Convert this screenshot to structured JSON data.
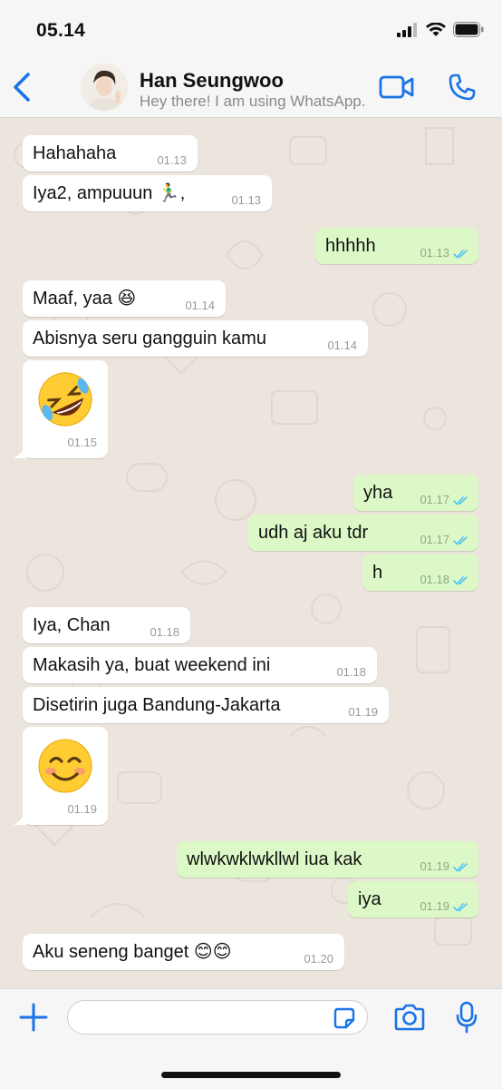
{
  "status_bar": {
    "time": "05.14"
  },
  "header": {
    "contact_name": "Han Seungwoo",
    "contact_status": "Hey there! I am using WhatsApp.",
    "back_icon": "chevron-left-icon",
    "video_icon": "video-camera-icon",
    "call_icon": "phone-icon"
  },
  "colors": {
    "accent": "#1a73e8",
    "incoming_bubble": "#ffffff",
    "outgoing_bubble": "#dcf8c6",
    "chat_background": "#ece5dd",
    "read_ticks": "#4fc3f7"
  },
  "messages": [
    {
      "direction": "in",
      "text": "Hahahaha",
      "time": "01.13"
    },
    {
      "direction": "in",
      "text": "Iya2, ampuuun 🏃‍♂️,",
      "time": "01.13"
    },
    {
      "direction": "out",
      "text": "hhhhh",
      "time": "01.13",
      "status": "read"
    },
    {
      "direction": "in",
      "text": "Maaf, yaa 😆",
      "time": "01.14"
    },
    {
      "direction": "in",
      "text": "Abisnya seru gangguin kamu",
      "time": "01.14"
    },
    {
      "direction": "in",
      "type": "sticker",
      "emoji": "rolling-on-floor-laughing",
      "time": "01.15"
    },
    {
      "direction": "out",
      "text": "yha",
      "time": "01.17",
      "status": "read"
    },
    {
      "direction": "out",
      "text": "udh aj aku tdr",
      "time": "01.17",
      "status": "read"
    },
    {
      "direction": "out",
      "text": "h",
      "time": "01.18",
      "status": "read"
    },
    {
      "direction": "in",
      "text": "Iya, Chan",
      "time": "01.18"
    },
    {
      "direction": "in",
      "text": "Makasih ya, buat weekend ini",
      "time": "01.18"
    },
    {
      "direction": "in",
      "text": "Disetirin juga Bandung-Jakarta",
      "time": "01.19"
    },
    {
      "direction": "in",
      "type": "sticker",
      "emoji": "smiling-face",
      "time": "01.19"
    },
    {
      "direction": "out",
      "text": "wlwkwklwkllwl iua kak",
      "time": "01.19",
      "status": "read"
    },
    {
      "direction": "out",
      "text": "iya",
      "time": "01.19",
      "status": "read"
    },
    {
      "direction": "in",
      "text": "Aku seneng banget 😊😊",
      "time": "01.20"
    }
  ],
  "input_bar": {
    "placeholder": "",
    "plus_icon": "plus-icon",
    "sticker_icon": "sticker-icon",
    "camera_icon": "camera-icon",
    "mic_icon": "microphone-icon"
  }
}
